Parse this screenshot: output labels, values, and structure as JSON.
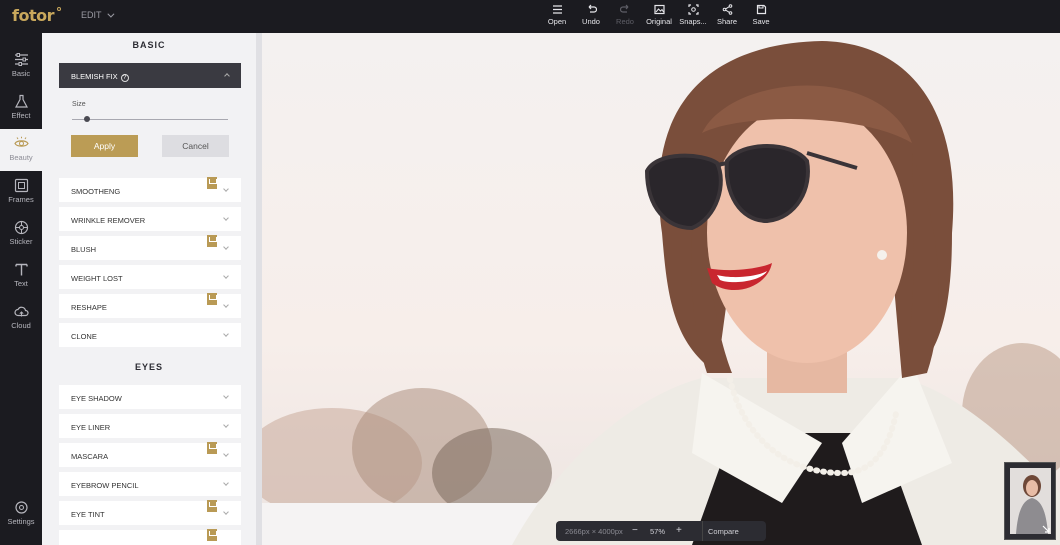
{
  "app": {
    "logo": "fotor",
    "edit_menu": "EDIT"
  },
  "toolbar": [
    {
      "label": "Open",
      "icon": "menu-icon",
      "enabled": true
    },
    {
      "label": "Undo",
      "icon": "undo-icon",
      "enabled": true
    },
    {
      "label": "Redo",
      "icon": "redo-icon",
      "enabled": false
    },
    {
      "label": "Original",
      "icon": "image-icon",
      "enabled": true
    },
    {
      "label": "Snaps...",
      "icon": "snapshot-icon",
      "enabled": true
    },
    {
      "label": "Share",
      "icon": "share-icon",
      "enabled": true
    },
    {
      "label": "Save",
      "icon": "floppy-icon",
      "enabled": true
    }
  ],
  "rail": [
    {
      "label": "Basic",
      "icon": "sliders-icon",
      "active": false
    },
    {
      "label": "Effect",
      "icon": "flask-icon",
      "active": false
    },
    {
      "label": "Beauty",
      "icon": "eye-icon",
      "active": true
    },
    {
      "label": "Frames",
      "icon": "frame-icon",
      "active": false
    },
    {
      "label": "Sticker",
      "icon": "sticker-icon",
      "active": false
    },
    {
      "label": "Text",
      "icon": "text-icon",
      "active": false
    },
    {
      "label": "Cloud",
      "icon": "cloud-icon",
      "active": false
    }
  ],
  "rail_settings": {
    "label": "Settings",
    "icon": "gear-icon"
  },
  "panel": {
    "basic_heading": "BASIC",
    "blemish": {
      "title": "BLEMISH FIX",
      "size_label": "Size",
      "size_value": 0.08,
      "apply": "Apply",
      "cancel": "Cancel"
    },
    "basic_tools": [
      {
        "label": "SMOOTHENG",
        "premium": true
      },
      {
        "label": "WRINKLE REMOVER",
        "premium": false
      },
      {
        "label": "BLUSH",
        "premium": true
      },
      {
        "label": "WEIGHT LOST",
        "premium": false
      },
      {
        "label": "RESHAPE",
        "premium": true
      },
      {
        "label": "CLONE",
        "premium": false
      }
    ],
    "eyes_heading": "EYES",
    "eyes_tools": [
      {
        "label": "EYE SHADOW",
        "premium": false
      },
      {
        "label": "EYE LINER",
        "premium": false
      },
      {
        "label": "MASCARA",
        "premium": true
      },
      {
        "label": "EYEBROW PENCIL",
        "premium": false
      },
      {
        "label": "EYE TINT",
        "premium": true
      }
    ]
  },
  "status": {
    "dimensions": "2666px × 4000px",
    "zoom": "57%",
    "compare": "Compare"
  },
  "colors": {
    "accent": "#bb9c55",
    "dark": "#1b1b20",
    "panel": "#f2f2f4"
  }
}
